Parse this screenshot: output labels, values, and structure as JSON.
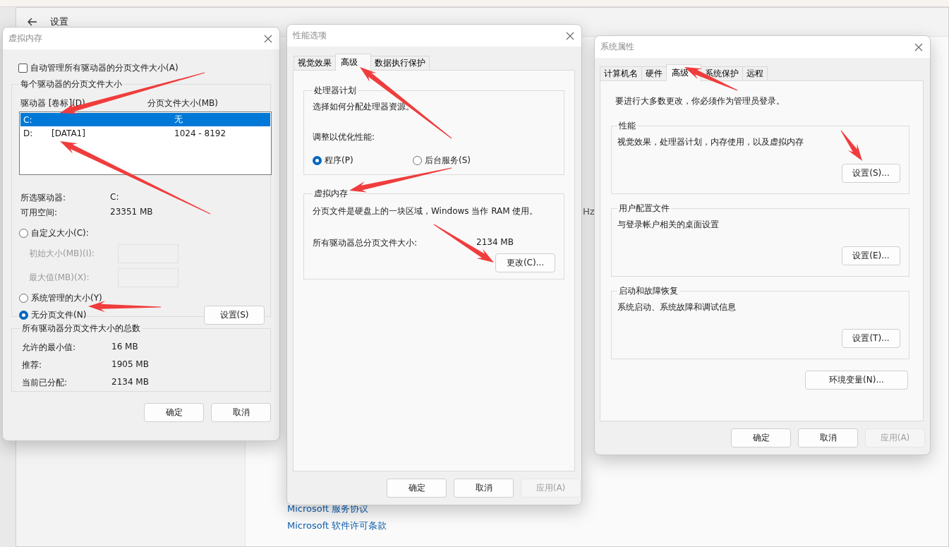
{
  "settings_window": {
    "title": "设置",
    "fragment": "Hz",
    "links": [
      "Microsoft 服务协议",
      "Microsoft 软件许可条款"
    ]
  },
  "virtual_memory_dialog": {
    "title": "虚拟内存",
    "auto_manage": {
      "label": "自动管理所有驱动器的分页文件大小(A)",
      "checked": false
    },
    "drives_group": {
      "title": "每个驱动器的分页文件大小",
      "columns": [
        "驱动器 [卷标](D)",
        "分页文件大小(MB)"
      ],
      "drives": [
        {
          "drive": "C:",
          "size": "无",
          "selected": true
        },
        {
          "drive": "D:",
          "volume": "[DATA1]",
          "size": "1024 - 8192",
          "selected": false
        }
      ],
      "info": [
        {
          "label": "所选驱动器:",
          "value": "C:"
        },
        {
          "label": "可用空间:",
          "value": "23351 MB"
        }
      ],
      "size_options": [
        {
          "kind": "radio",
          "label": "自定义大小(C):",
          "selected": false
        },
        {
          "kind": "field",
          "label": "初始大小(MB)(I):",
          "disabled": true
        },
        {
          "kind": "field",
          "label": "最大值(MB)(X):",
          "disabled": true
        },
        {
          "kind": "radio",
          "label": "系统管理的大小(Y)",
          "selected": false
        },
        {
          "kind": "radio",
          "label": "无分页文件(N)",
          "selected": true
        }
      ],
      "set_button": "设置(S)"
    },
    "totals_group": {
      "title": "所有驱动器分页文件大小的总数",
      "rows": [
        {
          "label": "允许的最小值:",
          "value": "16 MB"
        },
        {
          "label": "推荐:",
          "value": "1905 MB"
        },
        {
          "label": "当前已分配:",
          "value": "2134 MB"
        }
      ]
    },
    "buttons": [
      {
        "label": "确定",
        "disabled": false
      },
      {
        "label": "取消",
        "disabled": false
      }
    ]
  },
  "performance_dialog": {
    "title": "性能选项",
    "tabs": [
      {
        "label": "视觉效果",
        "selected": false
      },
      {
        "label": "高级",
        "selected": true
      },
      {
        "label": "数据执行保护",
        "selected": false
      }
    ],
    "processor_group": {
      "title": "处理器计划",
      "description": "选择如何分配处理器资源。",
      "prompt": "调整以优化性能:",
      "options": [
        {
          "label": "程序(P)",
          "selected": true
        },
        {
          "label": "后台服务(S)",
          "selected": false
        }
      ]
    },
    "memory_group": {
      "title": "虚拟内存",
      "description": "分页文件是硬盘上的一块区域，Windows 当作 RAM 使用。",
      "total_label": "所有驱动器总分页文件大小:",
      "total_value": "2134 MB",
      "button": "更改(C)..."
    },
    "buttons": [
      {
        "label": "确定",
        "disabled": false
      },
      {
        "label": "取消",
        "disabled": false
      },
      {
        "label": "应用(A)",
        "disabled": true
      }
    ]
  },
  "system_properties_dialog": {
    "title": "系统属性",
    "tabs": [
      {
        "label": "计算机名",
        "selected": false
      },
      {
        "label": "硬件",
        "selected": false
      },
      {
        "label": "高级",
        "selected": true
      },
      {
        "label": "系统保护",
        "selected": false
      },
      {
        "label": "远程",
        "selected": false
      }
    ],
    "notice": "要进行大多数更改，你必须作为管理员登录。",
    "groups": [
      {
        "title": "性能",
        "description": "视觉效果，处理器计划，内存使用，以及虚拟内存",
        "button": "设置(S)..."
      },
      {
        "title": "用户配置文件",
        "description": "与登录帐户相关的桌面设置",
        "button": "设置(E)..."
      },
      {
        "title": "启动和故障恢复",
        "description": "系统启动、系统故障和调试信息",
        "button": "设置(T)..."
      }
    ],
    "env_button": "环境变量(N)...",
    "buttons": [
      {
        "label": "确定",
        "disabled": false
      },
      {
        "label": "取消",
        "disabled": false
      },
      {
        "label": "应用(A)",
        "disabled": true
      }
    ]
  }
}
